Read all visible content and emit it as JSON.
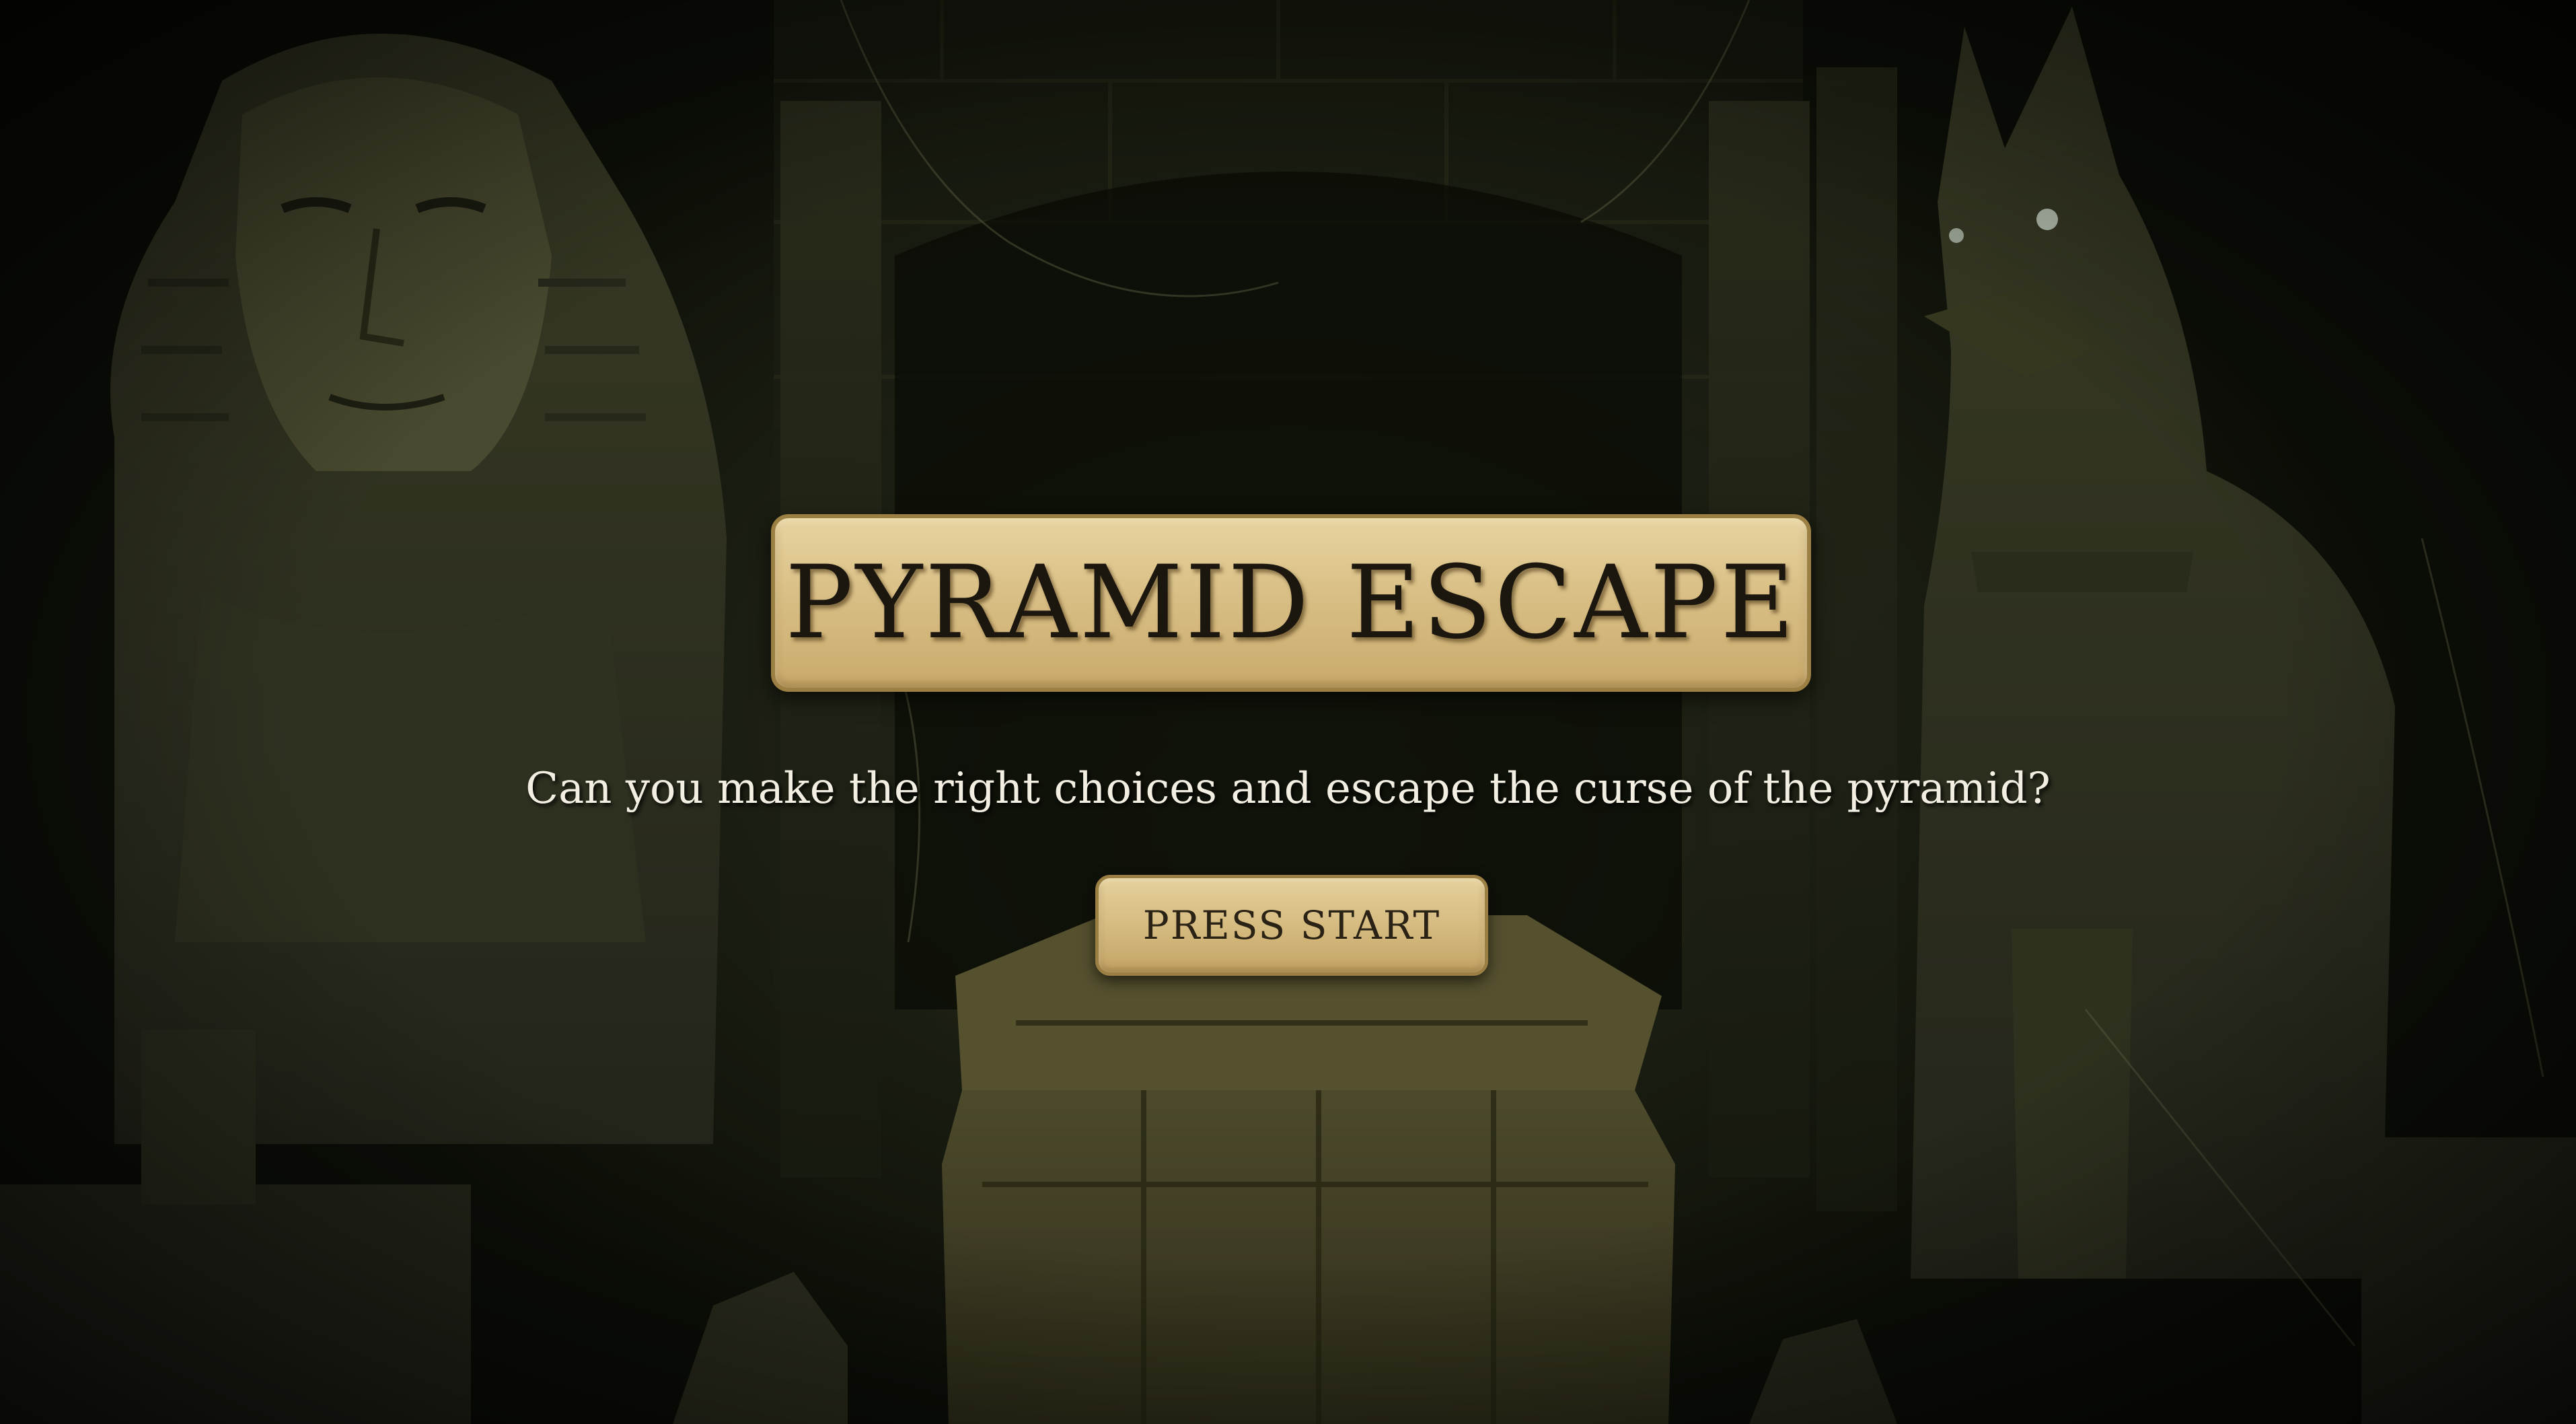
{
  "title_screen": {
    "game_title": "PYRAMID ESCAPE",
    "tagline": "Can you make the right choices and escape the curse of the pyramid?",
    "start_button_label": "PRESS START"
  },
  "background": {
    "elements": [
      "pharaoh-statue",
      "anubis-statue",
      "sarcophagus",
      "stone-pillars",
      "cobwebs",
      "rubble"
    ]
  },
  "colors": {
    "plate_fill": "#d9bf85",
    "plate_border": "#9c7f43",
    "title_text": "#1b160e",
    "tagline_text": "#f2eee2",
    "scene_dark": "#1a1d11"
  }
}
